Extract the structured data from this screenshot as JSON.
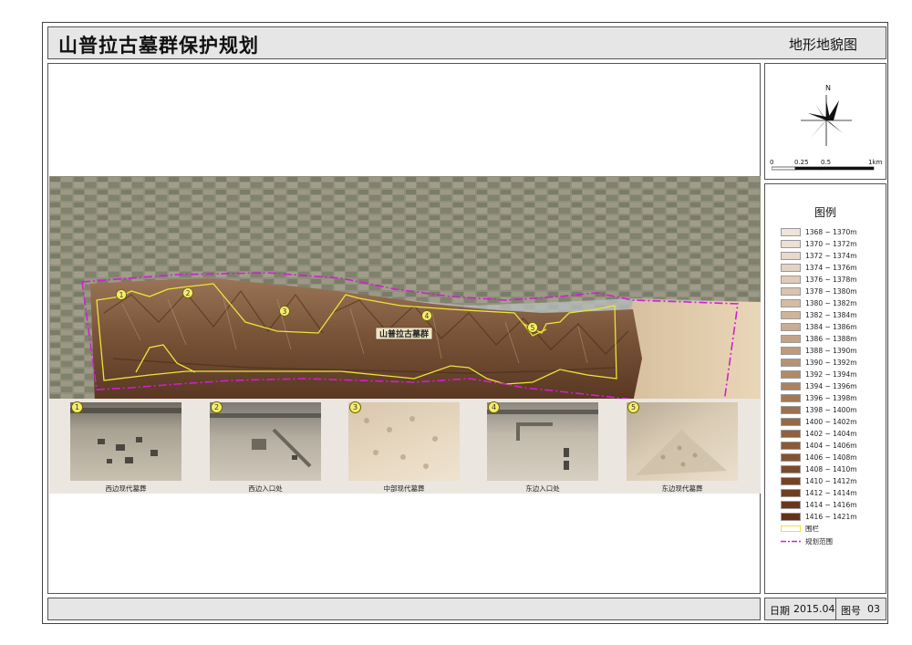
{
  "title": "山普拉古墓群保护规划",
  "subtitle": "地形地貌图",
  "compass": {
    "north": "N"
  },
  "scale_bar": {
    "labels": [
      "0",
      "0.25",
      "0.5",
      "1km"
    ]
  },
  "map": {
    "site_label": "山普拉古墓群",
    "markers": [
      "1",
      "2",
      "3",
      "4",
      "5"
    ]
  },
  "photos": [
    {
      "number": "1",
      "caption": "西边现代墓葬"
    },
    {
      "number": "2",
      "caption": "西边入口处"
    },
    {
      "number": "3",
      "caption": "中部现代墓葬"
    },
    {
      "number": "4",
      "caption": "东边入口处"
    },
    {
      "number": "5",
      "caption": "东边现代墓葬"
    }
  ],
  "legend": {
    "title": "图例",
    "elevation_classes": [
      {
        "label": "1368 ~ 1370m",
        "color": "#efe4da"
      },
      {
        "label": "1370 ~ 1372m",
        "color": "#ecdfd3"
      },
      {
        "label": "1372 ~ 1374m",
        "color": "#e8d9cb"
      },
      {
        "label": "1374 ~ 1376m",
        "color": "#e4d3c3"
      },
      {
        "label": "1376 ~ 1378m",
        "color": "#dfcbb9"
      },
      {
        "label": "1378 ~ 1380m",
        "color": "#dac4af"
      },
      {
        "label": "1380 ~ 1382m",
        "color": "#d4bca5"
      },
      {
        "label": "1382 ~ 1384m",
        "color": "#cfb49b"
      },
      {
        "label": "1384 ~ 1386m",
        "color": "#c9ac91"
      },
      {
        "label": "1386 ~ 1388m",
        "color": "#c3a387"
      },
      {
        "label": "1388 ~ 1390m",
        "color": "#bd9b7d"
      },
      {
        "label": "1390 ~ 1392m",
        "color": "#b69273"
      },
      {
        "label": "1392 ~ 1394m",
        "color": "#b08a69"
      },
      {
        "label": "1394 ~ 1396m",
        "color": "#aa8260"
      },
      {
        "label": "1396 ~ 1398m",
        "color": "#a37957"
      },
      {
        "label": "1398 ~ 1400m",
        "color": "#9d714f"
      },
      {
        "label": "1400 ~ 1402m",
        "color": "#966947"
      },
      {
        "label": "1402 ~ 1404m",
        "color": "#90613f"
      },
      {
        "label": "1404 ~ 1406m",
        "color": "#895938"
      },
      {
        "label": "1406 ~ 1408m",
        "color": "#835231"
      },
      {
        "label": "1408 ~ 1410m",
        "color": "#7c4b2b"
      },
      {
        "label": "1410 ~ 1412m",
        "color": "#764425"
      },
      {
        "label": "1412 ~ 1414m",
        "color": "#703e20"
      },
      {
        "label": "1414 ~ 1416m",
        "color": "#69381b"
      },
      {
        "label": "1416 ~ 1421m",
        "color": "#633317"
      }
    ],
    "fence": {
      "label": "围栏",
      "color": "#ece43a"
    },
    "planning_boundary": {
      "label": "规划范围",
      "color": "#d21ed2"
    }
  },
  "footer": {
    "date_label": "日期",
    "date_value": "2015.04",
    "sheet_label": "图号",
    "sheet_value": "03"
  },
  "colors": {
    "satellite_base": "#8d8c7a",
    "terrain_dark": "#5a3a22",
    "desert": "#e6cfae",
    "fence": "#ece43a",
    "boundary": "#d21ed2"
  }
}
